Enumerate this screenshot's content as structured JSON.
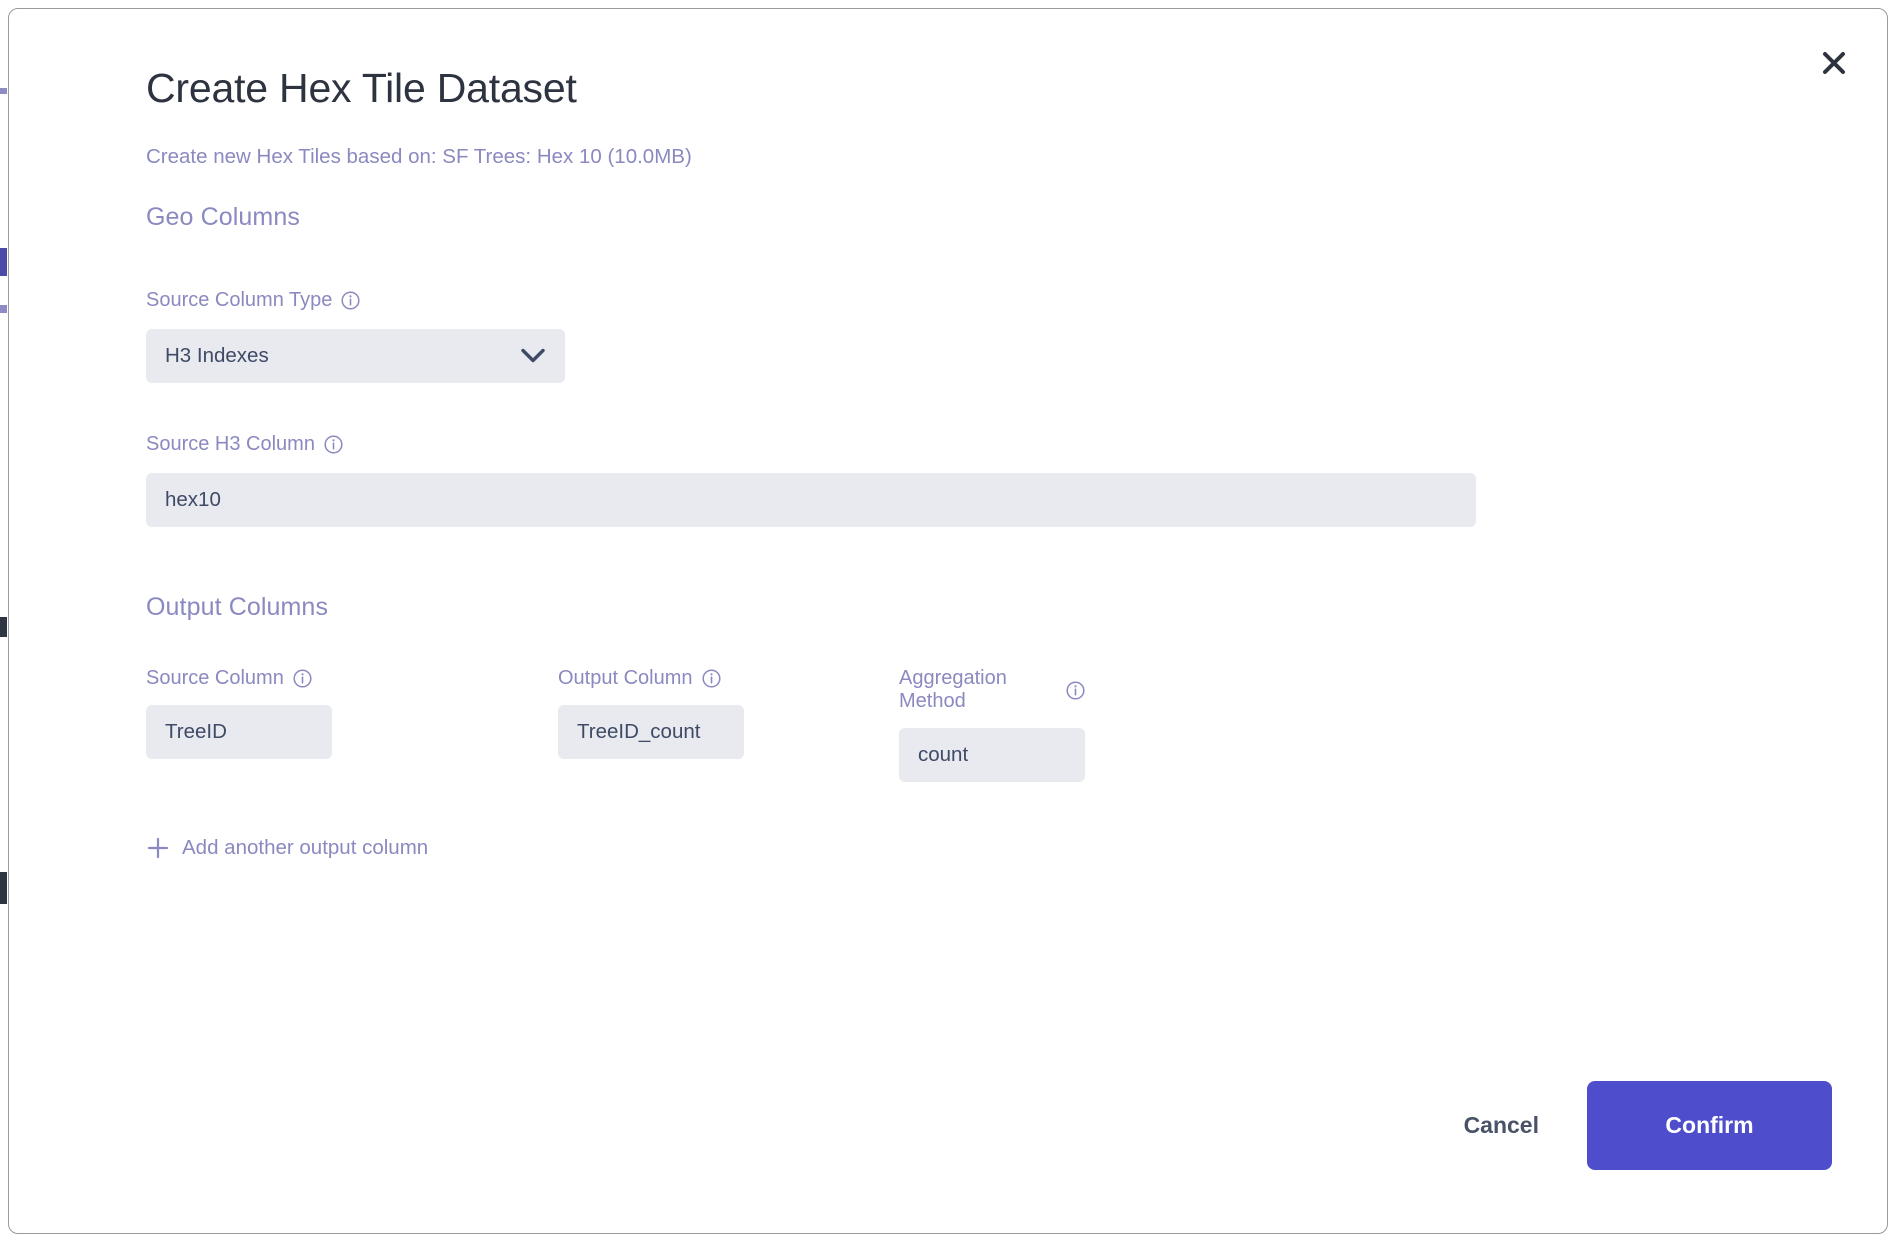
{
  "dialog": {
    "title": "Create Hex Tile Dataset",
    "subtitle": "Create new Hex Tiles based on: SF Trees: Hex 10 (10.0MB)",
    "close_label": "✕"
  },
  "geo_section": {
    "heading": "Geo Columns",
    "source_column_type": {
      "label": "Source Column Type",
      "value": "H3 Indexes"
    },
    "source_h3_column": {
      "label": "Source H3 Column",
      "value": "hex10"
    }
  },
  "output_section": {
    "heading": "Output Columns",
    "columns": [
      {
        "label": "Source Column",
        "value": "TreeID"
      },
      {
        "label": "Output Column",
        "value": "TreeID_count"
      },
      {
        "label": "Aggregation Method",
        "value": "count"
      }
    ],
    "add_link": "Add another output column"
  },
  "footer": {
    "cancel_label": "Cancel",
    "confirm_label": "Confirm"
  },
  "colors": {
    "accent": "#4e4dcb",
    "label": "#8a89c0",
    "field_bg": "#e9eaf0",
    "title": "#2d3440"
  }
}
